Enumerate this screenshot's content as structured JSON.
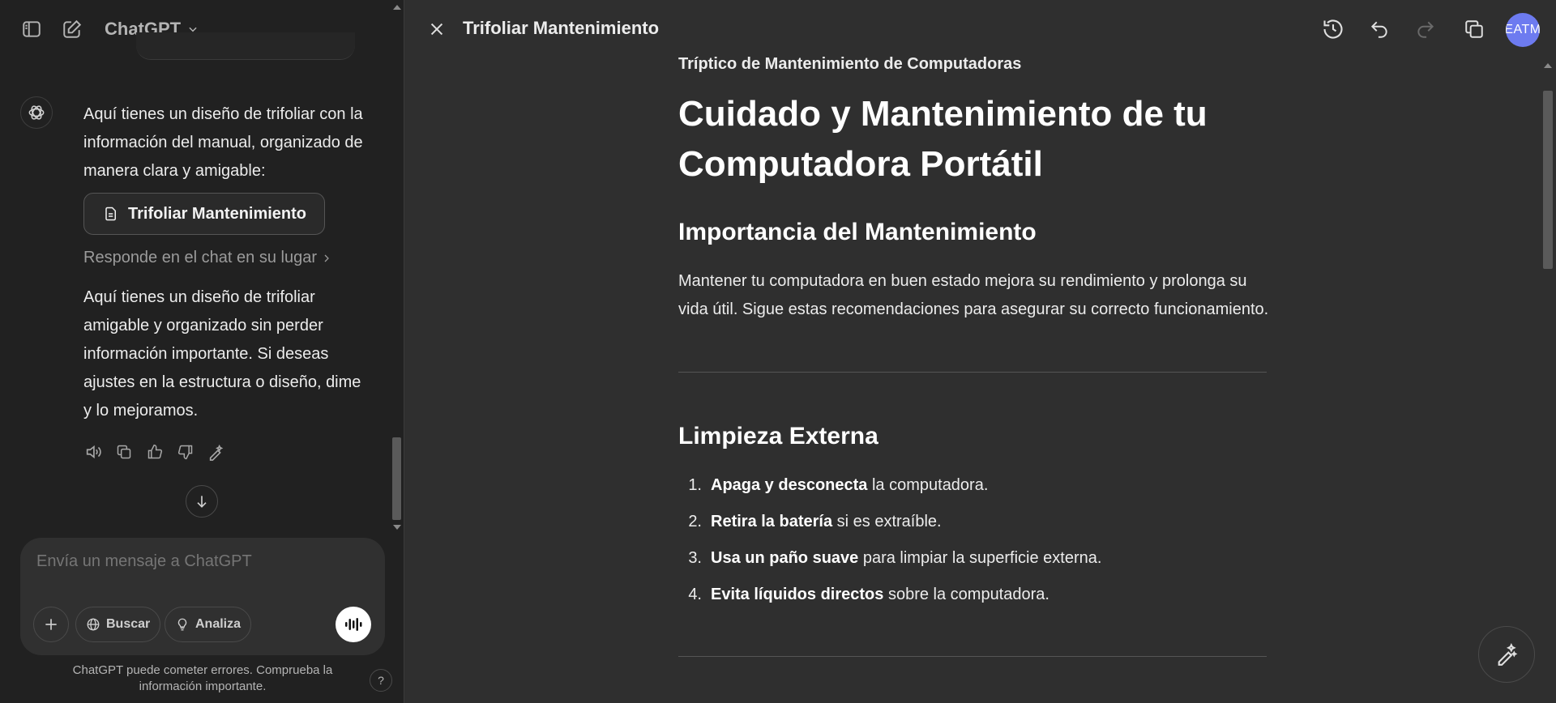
{
  "sidebar_header": {
    "model_name": "ChatGPT"
  },
  "chat": {
    "assistant_message_1": "Aquí tienes un diseño de trifoliar con la información del manual, organizado de manera clara y amigable:",
    "document_chip_label": "Trifoliar Mantenimiento",
    "reply_in_chat_link": "Responde en el chat en su lugar",
    "assistant_message_2": "Aquí tienes un diseño de trifoliar amigable y organizado sin perder información importante. Si deseas ajustes en la estructura o diseño, dime y lo mejoramos."
  },
  "composer": {
    "placeholder": "Envía un mensaje a ChatGPT",
    "search_label": "Buscar",
    "analyze_label": "Analiza",
    "disclaimer": "ChatGPT puede cometer errores. Comprueba la información importante.",
    "help_label": "?"
  },
  "canvas": {
    "title": "Trifoliar Mantenimiento",
    "avatar_initials": "EATM"
  },
  "document": {
    "subtitle": "Tríptico de Mantenimiento de Computadoras",
    "heading": "Cuidado y Mantenimiento de tu Computadora Portátil",
    "section_1_title": "Importancia del Mantenimiento",
    "section_1_text": "Mantener tu computadora en buen estado mejora su rendimiento y prolonga su vida útil. Sigue estas recomendaciones para asegurar su correcto funcionamiento.",
    "section_2_title": "Limpieza Externa",
    "steps": [
      {
        "num": "1.",
        "bold": "Apaga y desconecta",
        "rest": " la computadora."
      },
      {
        "num": "2.",
        "bold": "Retira la batería",
        "rest": " si es extraíble."
      },
      {
        "num": "3.",
        "bold": "Usa un paño suave",
        "rest": " para limpiar la superficie externa."
      },
      {
        "num": "4.",
        "bold": "Evita líquidos directos",
        "rest": " sobre la computadora."
      }
    ]
  },
  "colors": {
    "sidebar_bg": "#212121",
    "canvas_bg": "#2f2f2f",
    "avatar_bg": "#6d7bf0"
  }
}
